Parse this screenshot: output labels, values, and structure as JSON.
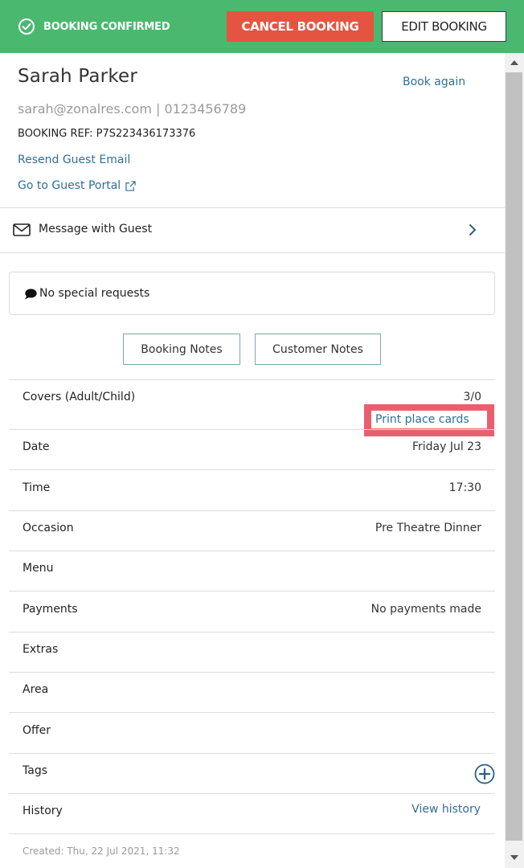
{
  "header": {
    "status_text": "BOOKING CONFIRMED",
    "cancel_label": "CANCEL BOOKING",
    "edit_label": "EDIT BOOKING",
    "colors": {
      "bar": "#4bb86f",
      "cancel": "#e55441"
    }
  },
  "guest": {
    "name": "Sarah Parker",
    "book_again": "Book again",
    "contact": "sarah@zonalres.com | 0123456789",
    "booking_ref": "BOOKING REF: P7S223436173376",
    "resend_email": "Resend Guest Email",
    "guest_portal": "Go to Guest Portal"
  },
  "message": {
    "label": "Message with Guest"
  },
  "special_requests": {
    "text": "No special requests"
  },
  "notes": {
    "booking_notes": "Booking Notes",
    "customer_notes": "Customer Notes"
  },
  "details": {
    "covers": {
      "label": "Covers (Adult/Child)",
      "value": "3/0",
      "print_link": "Print place cards"
    },
    "date": {
      "label": "Date",
      "value": "Friday Jul 23"
    },
    "time": {
      "label": "Time",
      "value": "17:30"
    },
    "occasion": {
      "label": "Occasion",
      "value": "Pre Theatre Dinner"
    },
    "menu": {
      "label": "Menu",
      "value": ""
    },
    "payments": {
      "label": "Payments",
      "value": "No payments made"
    },
    "extras": {
      "label": "Extras",
      "value": ""
    },
    "area": {
      "label": "Area",
      "value": ""
    },
    "offer": {
      "label": "Offer",
      "value": ""
    },
    "tags": {
      "label": "Tags"
    },
    "history": {
      "label": "History",
      "link": "View history"
    }
  },
  "footer": {
    "created": "Created: Thu, 22 Jul 2021, 11:32"
  }
}
